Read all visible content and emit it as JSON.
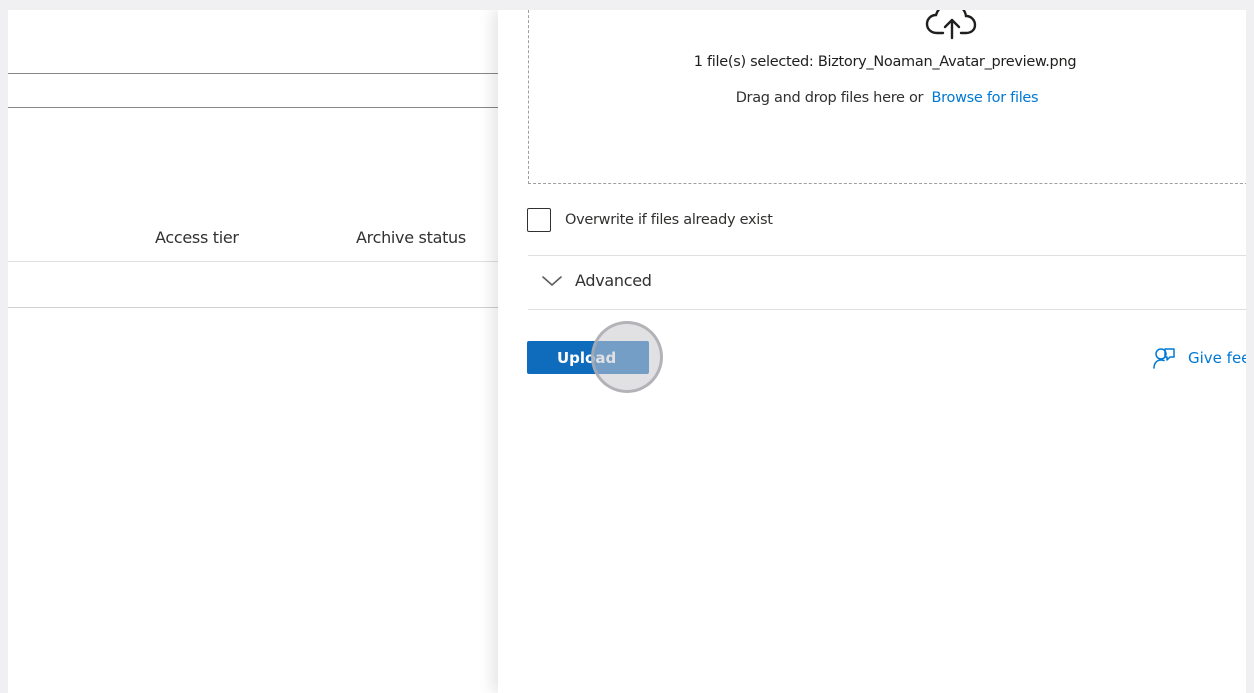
{
  "list": {
    "columns": {
      "access_tier": "Access tier",
      "archive_status": "Archive status"
    }
  },
  "upload_blade": {
    "cloud_icon": "cloud-upload-icon",
    "selected_text": "1 file(s) selected: Biztory_Noaman_Avatar_preview.png",
    "drag_text": "Drag and drop files here",
    "or_text": "or",
    "browse_link": "Browse for files",
    "overwrite_label": "Overwrite if files already exist",
    "overwrite_checked": false,
    "advanced_label": "Advanced",
    "upload_button": "Upload",
    "feedback_label": "Give fee"
  },
  "colors": {
    "accent": "#0078d4",
    "button": "#0f6cbd"
  }
}
